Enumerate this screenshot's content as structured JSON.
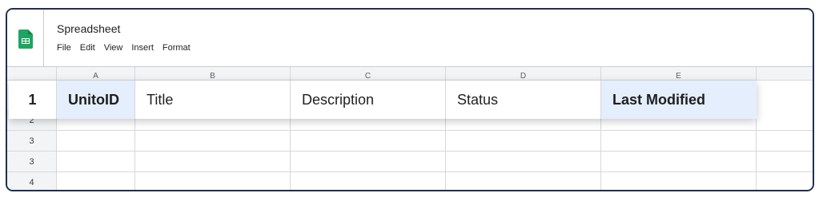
{
  "app": {
    "title": "Spreadsheet",
    "logo_icon": "sheets-logo-icon",
    "brand_color": "#1fa463"
  },
  "menu": [
    "File",
    "Edit",
    "View",
    "Insert",
    "Format"
  ],
  "columns": [
    "A",
    "B",
    "C",
    "D",
    "E"
  ],
  "header_row": {
    "row_number": "1",
    "cells": [
      "UnitoID",
      "Title",
      "Description",
      "Status",
      "Last Modified"
    ]
  },
  "rows": [
    {
      "number": "2"
    },
    {
      "number": "3"
    },
    {
      "number": "3"
    },
    {
      "number": "4"
    }
  ],
  "colors": {
    "window_border": "#1f2f4f",
    "highlight_cell": "#e4eefc"
  }
}
